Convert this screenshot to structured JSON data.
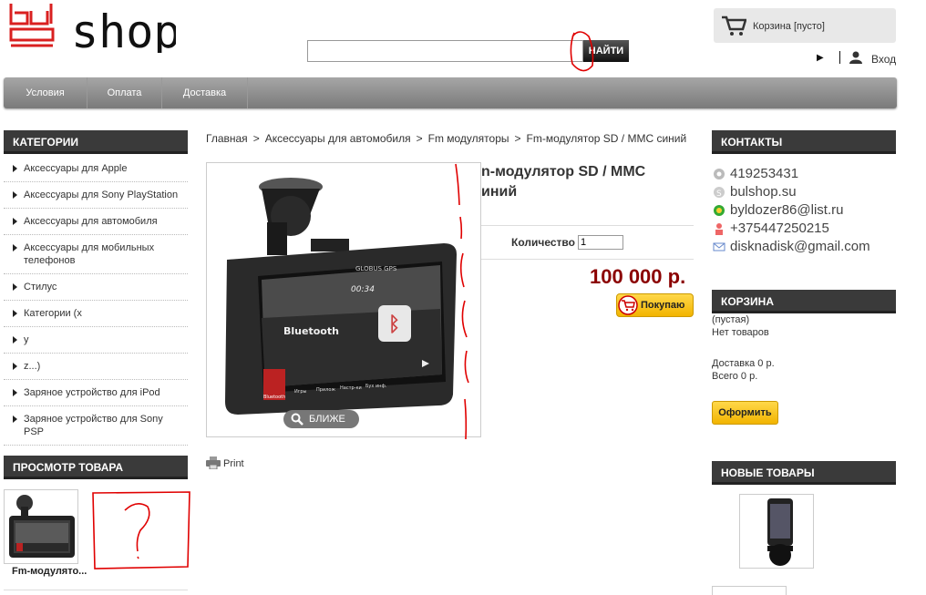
{
  "logo": {
    "text": "shop",
    "mark": "bul"
  },
  "search": {
    "placeholder": "",
    "value": "",
    "button_label": "НАЙТИ"
  },
  "cart_top": {
    "label": "Корзина [пусто]"
  },
  "user": {
    "login_label": "Вход"
  },
  "nav": {
    "items": [
      "Условия",
      "Оплата",
      "Доставка"
    ]
  },
  "categories": {
    "title": "КАТЕГОРИИ",
    "items": [
      "Аксессуары для Apple",
      "Аксессуары для Sony PlayStation",
      "Аксессуары для автомобиля",
      "Аксессуары для мобильных телефонов",
      "Стилус",
      "Категории (x",
      "y",
      "z...)",
      "Заряное устройство для iPod",
      "Заряное устройство для Sony PSP"
    ]
  },
  "viewed": {
    "title": "ПРОСМОТР ТОВАРА",
    "item_name": "Fm-модулято..."
  },
  "breadcrumb": [
    "Главная",
    "Аксессуары для автомобиля",
    "Fm модуляторы",
    "Fm-модулятор SD / MMC синий"
  ],
  "product": {
    "title_line1": "n-модулятор SD / MMC",
    "title_line2": "иний",
    "qty_label": "Количество",
    "qty_value": "1",
    "price": "100 000 р.",
    "buy_label": "Покупаю",
    "zoom_label": "БЛИЖЕ",
    "print_label": "Print",
    "screen": {
      "brand": "GLOBUS GPS",
      "time": "00:34",
      "title": "Bluetooth",
      "menu": [
        "Bluetooth",
        "Игры",
        "Прилож",
        "Настр-ки",
        "Бух инф."
      ]
    }
  },
  "contacts": {
    "title": "КОНТАКТЫ",
    "rows": [
      {
        "icon": "icq-icon",
        "text": "419253431"
      },
      {
        "icon": "skype-icon",
        "text": "bulshop.su"
      },
      {
        "icon": "mailru-agent-icon",
        "text": "byldozer86@list.ru"
      },
      {
        "icon": "phone-person-icon",
        "text": "+375447250215"
      },
      {
        "icon": "email-icon",
        "text": "disknadisk@gmail.com"
      }
    ]
  },
  "cart_block": {
    "title": "КОРЗИНА",
    "empty": "(пустая)",
    "no_items": "Нет товаров",
    "delivery": "Доставка 0 р.",
    "total": "Всего 0 р.",
    "checkout_label": "Оформить"
  },
  "new_products": {
    "title": "НОВЫЕ ТОВАРЫ"
  },
  "colors": {
    "header_dark": "#3a3a3a",
    "price": "#8b0000",
    "button_yellow": "#f2b400",
    "annotation_red": "#e00000"
  }
}
